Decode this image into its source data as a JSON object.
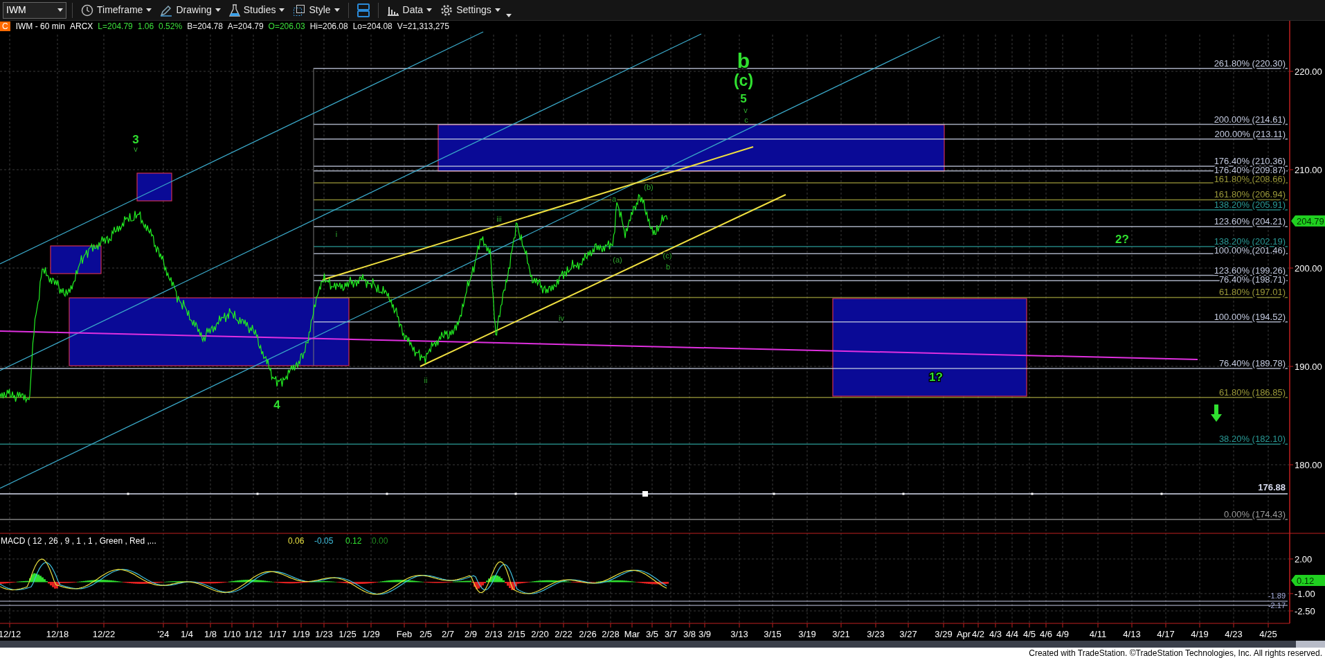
{
  "toolbar": {
    "symbol": "IWM",
    "buttons": [
      {
        "label": "Timeframe",
        "kind": "clock"
      },
      {
        "label": "Drawing",
        "kind": "pen"
      },
      {
        "label": "Studies",
        "kind": "flask"
      },
      {
        "label": "Style",
        "kind": "style"
      },
      {
        "label": "Data",
        "kind": "bars"
      },
      {
        "label": "Settings",
        "kind": "gear"
      }
    ]
  },
  "quote": {
    "status": "C",
    "symbol": "IWM - 60 min",
    "exchange": "ARCX",
    "fields": [
      {
        "text": "L=204.79",
        "kind": "up"
      },
      {
        "text": "1.06",
        "kind": "up"
      },
      {
        "text": "0.52%",
        "kind": "up"
      },
      {
        "text": "B=204.78",
        "kind": "plain"
      },
      {
        "text": "A=204.79",
        "kind": "plain"
      },
      {
        "text": "O=206.03",
        "kind": "up"
      },
      {
        "text": "Hi=206.08",
        "kind": "plain"
      },
      {
        "text": "Lo=204.08",
        "kind": "plain"
      },
      {
        "text": "V=21,313,275",
        "kind": "plain"
      }
    ]
  },
  "chart": {
    "price_axis": [
      "220.00",
      "210.00",
      "200.00",
      "190.00",
      "180.00"
    ],
    "last_price": "204.79",
    "fib_levels": [
      {
        "label": "261.80% (220.30)",
        "color": "#c4cbe0"
      },
      {
        "label": "200.00% (214.61)",
        "color": "#c4cbe0"
      },
      {
        "label": "200.00% (213.11)",
        "color": "#c4cbe0"
      },
      {
        "label": "176.40% (210.36)",
        "color": "#c4cbe0"
      },
      {
        "label": "176.40% (209.87)",
        "color": "#c4cbe0"
      },
      {
        "label": "161.80% (208.66)",
        "color": "#9c9a3a"
      },
      {
        "label": "161.80% (206.94)",
        "color": "#9c9a3a"
      },
      {
        "label": "138.20% (205.91)",
        "color": "#2a9a96"
      },
      {
        "label": "123.60% (204.21)",
        "color": "#c4cbe0"
      },
      {
        "label": "138.20% (202.19)",
        "color": "#2a9a96"
      },
      {
        "label": "100.00% (201.46)",
        "color": "#c4cbe0"
      },
      {
        "label": "123.60% (199.26)",
        "color": "#c4cbe0"
      },
      {
        "label": "76.40% (198.71)",
        "color": "#c4cbe0"
      },
      {
        "label": "61.80% (197.01)",
        "color": "#9c9a3a"
      },
      {
        "label": "100.00% (194.52)",
        "color": "#c4cbe0"
      },
      {
        "label": "76.40% (189.78)",
        "color": "#c4cbe0"
      },
      {
        "label": "61.80% (186.85)",
        "color": "#9c9a3a"
      },
      {
        "label": "38.20% (182.10)",
        "color": "#2a9a96"
      },
      {
        "label": "0.00% (174.43)",
        "color": "#9a9a9a"
      }
    ],
    "line_label": "176.88",
    "wave_labels": [
      {
        "text": "b",
        "kind": "major"
      },
      {
        "text": "(c)",
        "kind": "major"
      },
      {
        "text": "5",
        "kind": "medium"
      },
      {
        "text": "v",
        "kind": "minor"
      },
      {
        "text": "c",
        "kind": "minor"
      },
      {
        "text": "3",
        "kind": "medium"
      },
      {
        "text": "v",
        "kind": "minor"
      },
      {
        "text": "i",
        "kind": "minor"
      },
      {
        "text": "iii",
        "kind": "minor"
      },
      {
        "text": "a",
        "kind": "minor"
      },
      {
        "text": "(b)",
        "kind": "minor"
      },
      {
        "text": "2?",
        "kind": "medium"
      },
      {
        "text": "(a)",
        "kind": "minor"
      },
      {
        "text": "(c)",
        "kind": "minor"
      },
      {
        "text": "b",
        "kind": "minor"
      },
      {
        "text": "iv",
        "kind": "minor"
      },
      {
        "text": "1?",
        "kind": "medium"
      },
      {
        "text": "ii",
        "kind": "minor"
      },
      {
        "text": "4",
        "kind": "medium"
      }
    ],
    "date_axis": [
      "12/12",
      "12/18",
      "12/22",
      "'24",
      "1/4",
      "1/8",
      "1/10",
      "1/12",
      "1/17",
      "1/19",
      "1/23",
      "1/25",
      "1/29",
      "Feb",
      "2/5",
      "2/7",
      "2/9",
      "2/13",
      "2/15",
      "2/20",
      "2/22",
      "2/26",
      "2/28",
      "Mar",
      "3/5",
      "3/7",
      "3/8",
      "3/9",
      "3/13",
      "3/15",
      "3/19",
      "3/21",
      "3/23",
      "3/27",
      "3/29",
      "Apr",
      "4/2",
      "4/3",
      "4/4",
      "4/5",
      "4/6",
      "4/9",
      "4/11",
      "4/13",
      "4/17",
      "4/19",
      "4/23",
      "4/25"
    ]
  },
  "macd": {
    "title": "MACD ( 12 , 26 , 9 , 1 , 1 , Green , Red ,...",
    "values": [
      {
        "text": "0.06",
        "color": "#e8e040"
      },
      {
        "text": "-0.05",
        "color": "#40c0e0"
      },
      {
        "text": "0.12",
        "color": "#30e030"
      },
      {
        "text": "0.00",
        "color": "#208a20"
      }
    ],
    "axis": [
      "2.00",
      "-1.00",
      "-2.50"
    ],
    "last_value": "0.12",
    "line_labels": [
      "-1.89",
      "-2.17"
    ]
  },
  "footer": "Created with TradeStation. ©TradeStation Technologies, Inc. All rights reserved."
}
